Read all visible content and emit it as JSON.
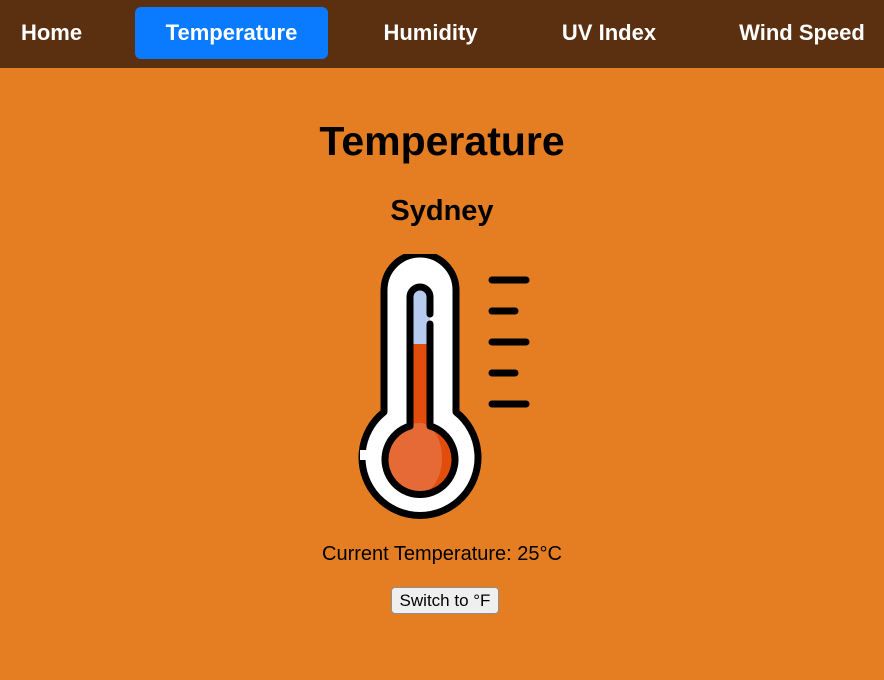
{
  "nav": {
    "items": [
      {
        "label": "Home"
      },
      {
        "label": "Temperature"
      },
      {
        "label": "Humidity"
      },
      {
        "label": "UV Index"
      },
      {
        "label": "Wind Speed"
      }
    ],
    "active_index": 1
  },
  "main": {
    "title": "Temperature",
    "city": "Sydney",
    "current_temperature": "Current Temperature: 25°C",
    "switch_button_label": "Switch to °F",
    "icon": "thermometer-icon"
  },
  "colors": {
    "background": "#e57e22",
    "navbar": "#5a3011",
    "active_tab": "#0a7bff",
    "nav_text": "#ffffff",
    "mercury": "#e34d0b",
    "bulb_highlight": "#e56a35",
    "tube_empty": "#b7caf0"
  }
}
